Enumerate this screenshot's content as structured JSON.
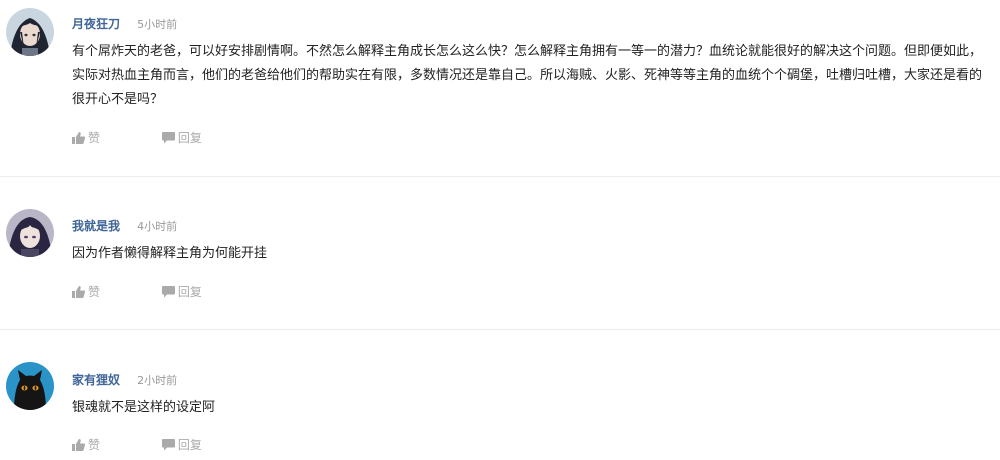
{
  "comments": [
    {
      "username": "月夜狂刀",
      "time": "5小时前",
      "text": "有个屌炸天的老爸，可以好安排剧情啊。不然怎么解释主角成长怎么这么快？怎么解释主角拥有一等一的潜力？血统论就能很好的解决这个问题。但即便如此，实际对热血主角而言，他们的老爸给他们的帮助实在有限，多数情况还是靠自己。所以海贼、火影、死神等等主角的血统个个碉堡，吐槽归吐槽，大家还是看的很开心不是吗？",
      "like_label": "赞",
      "reply_label": "回复",
      "avatar_icon": "anime-character-avatar"
    },
    {
      "username": "我就是我",
      "time": "4小时前",
      "text": "因为作者懒得解释主角为何能开挂",
      "like_label": "赞",
      "reply_label": "回复",
      "avatar_icon": "anime-character-avatar"
    },
    {
      "username": "家有狸奴",
      "time": "2小时前",
      "text": "银魂就不是这样的设定阿",
      "like_label": "赞",
      "reply_label": "回复",
      "avatar_icon": "black-cat-avatar"
    }
  ],
  "colors": {
    "username": "#406599",
    "time": "#999999",
    "text": "#222222",
    "action": "#aaaaaa",
    "divider": "#ececec"
  }
}
